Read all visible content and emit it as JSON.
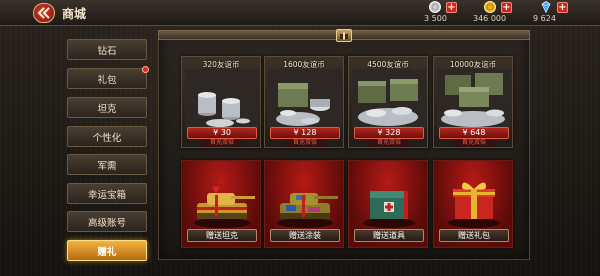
{
  "header": {
    "title": "商城",
    "back_icon": "back-chevrons-icon"
  },
  "resources": [
    {
      "name": "silver",
      "icon": "silver-coin-icon",
      "value": "3 500",
      "color": "#c9ccd1"
    },
    {
      "name": "gold",
      "icon": "gold-coin-icon",
      "value": "346 000",
      "color": "#e7b21e"
    },
    {
      "name": "diamond",
      "icon": "diamond-icon",
      "value": "9 624",
      "color": "#4aa8ff"
    }
  ],
  "menu": {
    "items": [
      {
        "label": "钻石",
        "active": false,
        "badge": false
      },
      {
        "label": "礼包",
        "active": false,
        "badge": true
      },
      {
        "label": "坦克",
        "active": false,
        "badge": false
      },
      {
        "label": "个性化",
        "active": false,
        "badge": false
      },
      {
        "label": "军需",
        "active": false,
        "badge": false
      },
      {
        "label": "幸运宝箱",
        "active": false,
        "badge": false
      },
      {
        "label": "高级账号",
        "active": false,
        "badge": false
      },
      {
        "label": "赠礼",
        "active": true,
        "badge": false
      }
    ]
  },
  "currency_packs": [
    {
      "label": "320友谊币",
      "price": "¥ 30",
      "tag": "首充双倍"
    },
    {
      "label": "1600友谊币",
      "price": "¥ 128",
      "tag": "首充双倍"
    },
    {
      "label": "4500友谊币",
      "price": "¥ 328",
      "tag": "首充双倍"
    },
    {
      "label": "10000友谊币",
      "price": "¥ 648",
      "tag": "首充双倍"
    }
  ],
  "gifts": [
    {
      "label": "赠送坦克",
      "icon": "gold-tank-icon"
    },
    {
      "label": "赠送涂装",
      "icon": "camo-tank-icon"
    },
    {
      "label": "赠送道具",
      "icon": "supply-crate-icon"
    },
    {
      "label": "赠送礼包",
      "icon": "gift-box-icon"
    }
  ],
  "colors": {
    "accent": "#f5b53d",
    "price_red": "#b3271d",
    "gift_red": "#b51a16"
  }
}
